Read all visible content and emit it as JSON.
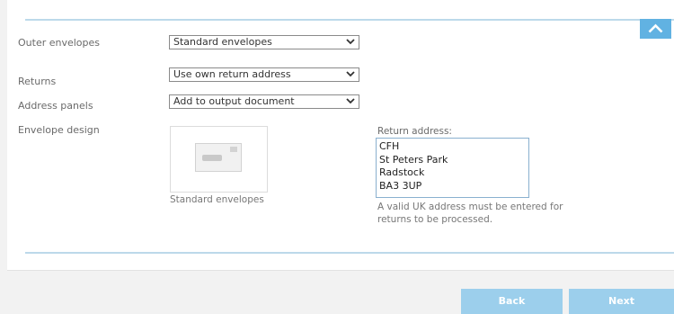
{
  "form": {
    "rows": [
      {
        "label": "Outer envelopes",
        "value": "Standard envelopes"
      },
      {
        "label": "Returns",
        "value": "Use own return address"
      },
      {
        "label": "Address panels",
        "value": "Add to output document"
      }
    ],
    "envelope_design_label": "Envelope design",
    "envelope_caption": "Standard envelopes",
    "return_address_label": "Return address:",
    "return_address_lines": [
      "CFH",
      "St Peters Park",
      "Radstock",
      "BA3 3UP"
    ],
    "return_note": "A valid UK address must be entered for returns to be processed."
  },
  "footer": {
    "back_label": "Back",
    "next_label": "Next"
  },
  "colors": {
    "accent": "#61b2e2",
    "button": "#9ccfec",
    "rule": "#bcd9ea"
  },
  "icons": {
    "collapse": "chevron-up-icon",
    "select_arrow": "chevron-down-icon",
    "envelope": "envelope-icon"
  }
}
